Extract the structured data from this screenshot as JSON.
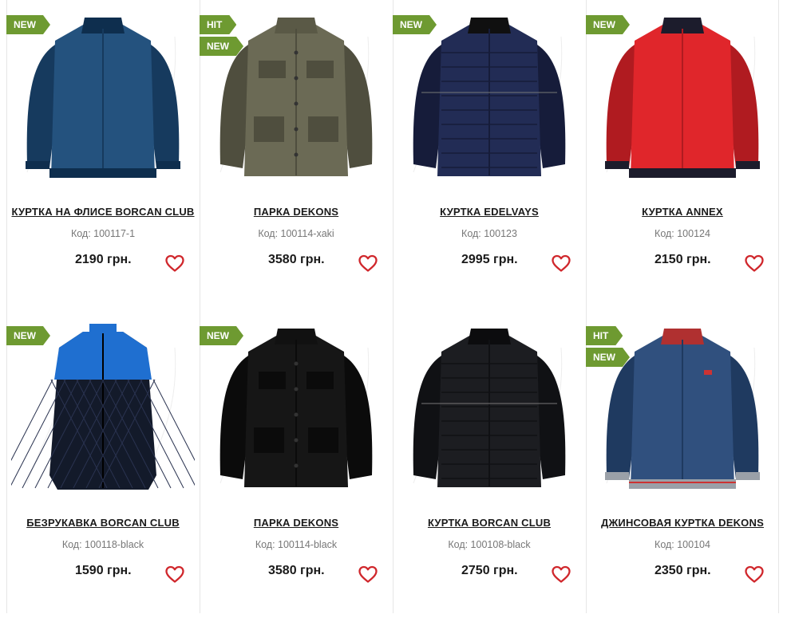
{
  "products": [
    {
      "badges": [
        "NEW"
      ],
      "title": "КУРТКА НА ФЛИСЕ BORCAN CLUB",
      "code": "Код: 100117-1",
      "price": "2190 грн.",
      "color": "#24527e",
      "shade": "#163a5e",
      "collar": "#0e2e4e",
      "style": "bomber"
    },
    {
      "badges": [
        "HIT",
        "NEW"
      ],
      "title": "ПАРКА DEKONS",
      "code": "Код: 100114-xaki",
      "price": "3580 грн.",
      "color": "#6b6a55",
      "shade": "#4f4e3e",
      "collar": "#5a5946",
      "style": "parka"
    },
    {
      "badges": [
        "NEW"
      ],
      "title": "КУРТКА EDELVAYS",
      "code": "Код: 100123",
      "price": "2995 грн.",
      "color": "#222c55",
      "shade": "#161c3a",
      "collar": "#101010",
      "style": "quilt"
    },
    {
      "badges": [
        "NEW"
      ],
      "title": "КУРТКА ANNEX",
      "code": "Код: 100124",
      "price": "2150 грн.",
      "color": "#e0262b",
      "shade": "#b01b20",
      "collar": "#1c1c2c",
      "style": "bomber"
    },
    {
      "badges": [
        "NEW"
      ],
      "title": "БЕЗРУКАВКА BORCAN CLUB",
      "code": "Код: 100118-black",
      "price": "1590 грн.",
      "color": "#131a2a",
      "shade": "#0c1220",
      "collar": "#1f6fd0",
      "style": "vest"
    },
    {
      "badges": [
        "NEW"
      ],
      "title": "ПАРКА DEKONS",
      "code": "Код: 100114-black",
      "price": "3580 грн.",
      "color": "#161616",
      "shade": "#0b0b0b",
      "collar": "#111111",
      "style": "parka"
    },
    {
      "badges": [],
      "title": "КУРТКА BORCAN CLUB",
      "code": "Код: 100108-black",
      "price": "2750 грн.",
      "color": "#1c1d21",
      "shade": "#101114",
      "collar": "#0c0c0e",
      "style": "quilt"
    },
    {
      "badges": [
        "HIT",
        "NEW"
      ],
      "title": "ДЖИНСОВАЯ КУРТКА DEKONS",
      "code": "Код: 100104",
      "price": "2350 грн.",
      "color": "#30507e",
      "shade": "#1f3a60",
      "collar": "#b03030",
      "style": "denim"
    }
  ],
  "icons": {
    "favorite": "heart-icon"
  },
  "colors": {
    "badge": "#6e9a31",
    "heart": "#d0272c"
  }
}
